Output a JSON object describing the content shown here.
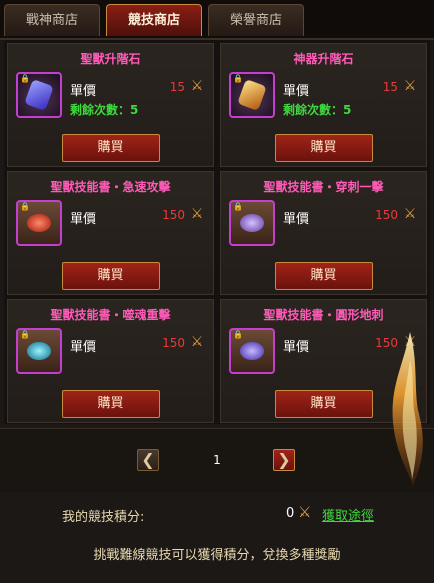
{
  "tabs": [
    {
      "label": "戰神商店"
    },
    {
      "label": "競技商店"
    },
    {
      "label": "榮譽商店"
    }
  ],
  "active_tab": 1,
  "items": [
    {
      "title": "聖獸升階石",
      "price_label": "單價",
      "price": "15",
      "remaining": "剩餘次數：5",
      "buy_label": "購買",
      "icon": "blue-crystal-icon",
      "gem_color": "#5a4cff"
    },
    {
      "title": "神器升階石",
      "price_label": "單價",
      "price": "15",
      "remaining": "剩餘次數：5",
      "buy_label": "購買",
      "icon": "gold-crystal-icon",
      "gem_color": "#e5a62a"
    },
    {
      "title": "聖獸技能書・急速攻擊",
      "price_label": "單價",
      "price": "150",
      "buy_label": "購買",
      "icon": "skill-book-red-icon",
      "gem_color": "#d83a2a"
    },
    {
      "title": "聖獸技能書・穿刺一擊",
      "price_label": "單價",
      "price": "150",
      "buy_label": "購買",
      "icon": "skill-book-purple-icon",
      "gem_color": "#8a6ac8"
    },
    {
      "title": "聖獸技能書・噬魂重擊",
      "price_label": "單價",
      "price": "150",
      "buy_label": "購買",
      "icon": "skill-book-cyan-icon",
      "gem_color": "#2ec8d8"
    },
    {
      "title": "聖獸技能書・圓形地刺",
      "price_label": "單價",
      "price": "150",
      "buy_label": "購買",
      "icon": "skill-book-violet-icon",
      "gem_color": "#6a4ae0"
    }
  ],
  "pager": {
    "page": "1",
    "prev": "❮",
    "next": "❯"
  },
  "points": {
    "label": "我的競技積分:",
    "value": "0",
    "link": "獲取途徑",
    "hint": "挑戰難線競技可以獲得積分，兌換多種獎勵"
  },
  "colors": {
    "title": "#ff5ab8",
    "price": "#e83a3a",
    "remaining": "#3fd83f",
    "currency": "#e0a040"
  }
}
